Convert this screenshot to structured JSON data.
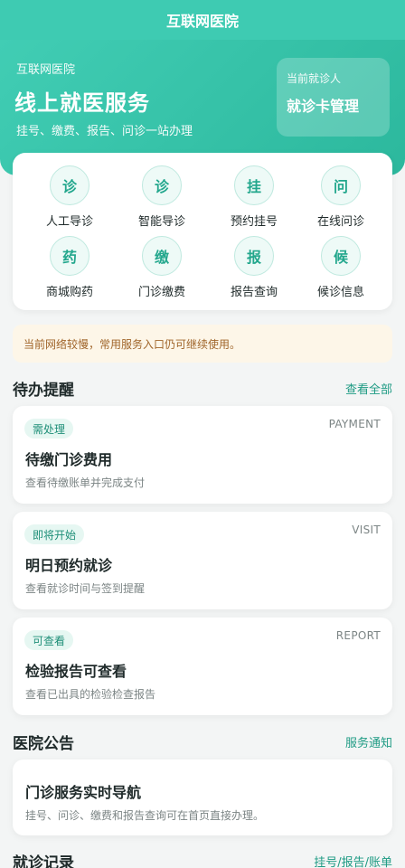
{
  "topbar": {
    "title": "互联网医院"
  },
  "hero": {
    "subtitle": "互联网医院",
    "title": "线上就医服务",
    "description": "挂号、缴费、报告、问诊一站办理",
    "patient": {
      "label": "当前就诊人",
      "action": "就诊卡管理"
    }
  },
  "services": [
    {
      "icon": "诊",
      "label": "人工导诊"
    },
    {
      "icon": "诊",
      "label": "智能导诊"
    },
    {
      "icon": "挂",
      "label": "预约挂号"
    },
    {
      "icon": "问",
      "label": "在线问诊"
    },
    {
      "icon": "药",
      "label": "商城购药"
    },
    {
      "icon": "缴",
      "label": "门诊缴费"
    },
    {
      "icon": "报",
      "label": "报告查询"
    },
    {
      "icon": "候",
      "label": "候诊信息"
    }
  ],
  "notice": {
    "text": "当前网络较慢，常用服务入口仍可继续使用。"
  },
  "todo_section": {
    "title": "待办提醒",
    "link": "查看全部"
  },
  "todos": [
    {
      "badge": "需处理",
      "code": "PAYMENT",
      "title": "待缴门诊费用",
      "desc": "查看待缴账单并完成支付"
    },
    {
      "badge": "即将开始",
      "code": "VISIT",
      "title": "明日预约就诊",
      "desc": "查看就诊时间与签到提醒"
    },
    {
      "badge": "可查看",
      "code": "REPORT",
      "title": "检验报告可查看",
      "desc": "查看已出具的检验检查报告"
    }
  ],
  "announce_section": {
    "title": "医院公告",
    "link": "服务通知"
  },
  "announcement": {
    "title": "门诊服务实时导航",
    "desc": "挂号、问诊、缴费和报告查询可在首页直接办理。"
  },
  "records_section": {
    "title": "就诊记录",
    "link": "挂号/报告/账单"
  },
  "colors": {
    "brand": "#3ecbb2",
    "brand_dark": "#23a78d",
    "notice_bg": "#fdf6e8",
    "notice_text": "#a0652a"
  }
}
